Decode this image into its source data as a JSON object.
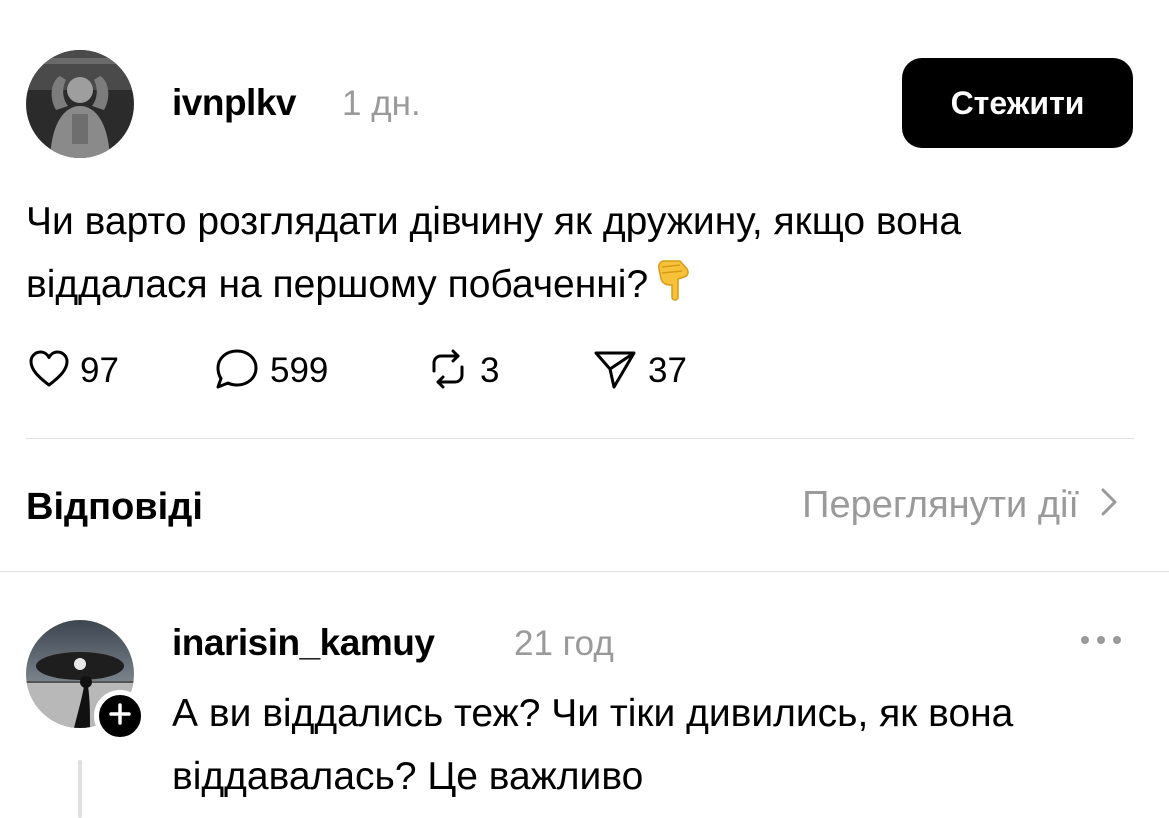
{
  "post": {
    "username": "ivnplkv",
    "time": "1 дн.",
    "follow_label": "Стежити",
    "text": "Чи варто розглядати дівчину як дружину, якщо вона віддалася на першому побаченні?",
    "emoji": "backhand-index-pointing-down",
    "stats": {
      "likes": "97",
      "comments": "599",
      "reposts": "3",
      "shares": "37"
    }
  },
  "replies_section": {
    "heading": "Відповіді",
    "view_activity": "Переглянути дії"
  },
  "reply": {
    "username": "inarisin_kamuy",
    "time": "21 год",
    "text": "А ви віддались теж? Чи тіки дивились, як вона віддавалась? Це важливо"
  },
  "icons": {
    "like": "heart-icon",
    "comment": "comment-bubble-icon",
    "repost": "repost-icon",
    "share": "send-icon",
    "chevron": "chevron-right-icon",
    "plus": "plus-icon",
    "more": "more-dots-icon"
  },
  "colors": {
    "primary": "#000000",
    "muted": "#9a9a9a",
    "divider": "#e2e2e2",
    "background": "#ffffff"
  }
}
